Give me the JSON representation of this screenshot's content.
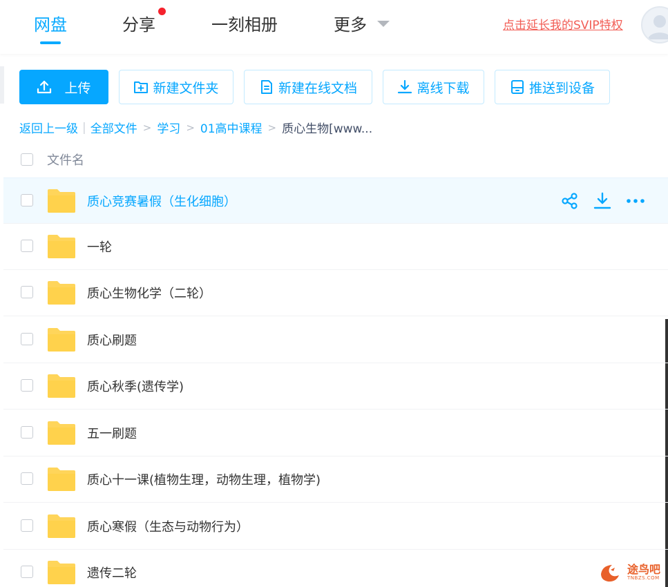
{
  "nav": {
    "tabs": [
      {
        "label": "网盘",
        "active": true
      },
      {
        "label": "分享",
        "badge_dot": true
      },
      {
        "label": "一刻相册"
      },
      {
        "label": "更多"
      }
    ],
    "svip_link": "点击延长我的SVIP特权",
    "accent_color": "#09AAFF"
  },
  "toolbar": {
    "upload": "上传",
    "new_folder": "新建文件夹",
    "new_doc": "新建在线文档",
    "offline_download": "离线下载",
    "push_device": "推送到设备"
  },
  "breadcrumb": {
    "back": "返回上一级",
    "items": [
      "全部文件",
      "学习",
      "01高中课程"
    ],
    "current": "质心生物[www..."
  },
  "list": {
    "header": "文件名",
    "rows": [
      {
        "name": "质心竞赛暑假（生化细胞）",
        "hovered": true
      },
      {
        "name": "一轮"
      },
      {
        "name": "质心生物化学（二轮）"
      },
      {
        "name": "质心刷题"
      },
      {
        "name": "质心秋季(遗传学)"
      },
      {
        "name": "五一刷题"
      },
      {
        "name": "质心十一课(植物生理，动物生理，植物学)"
      },
      {
        "name": "质心寒假（生态与动物行为）"
      },
      {
        "name": "遗传二轮"
      }
    ],
    "row_actions": [
      "share-icon",
      "download-icon",
      "more-icon"
    ]
  },
  "watermark": {
    "text": "途鸟吧",
    "sub": "TNBZS.COM"
  }
}
